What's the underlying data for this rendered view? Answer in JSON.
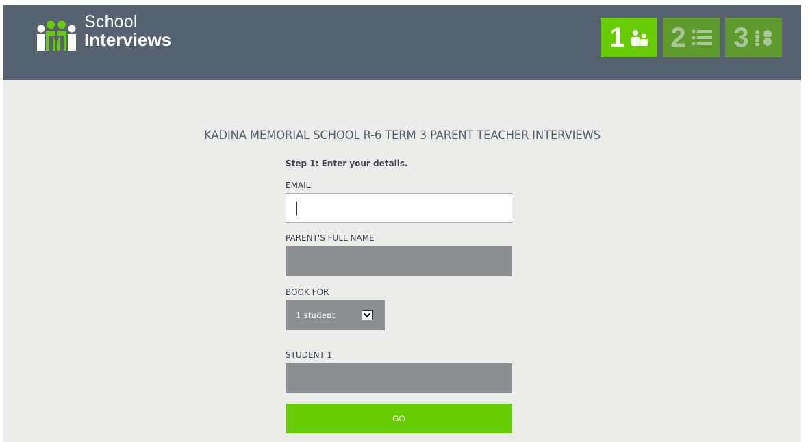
{
  "brand": {
    "line1": "School",
    "line2": "Interviews"
  },
  "steps": [
    {
      "number": "1",
      "icon": "people-icon",
      "state": "active"
    },
    {
      "number": "2",
      "icon": "list-icon",
      "state": "inactive"
    },
    {
      "number": "3",
      "icon": "people-list-icon",
      "state": "inactive"
    }
  ],
  "page": {
    "title": "KADINA MEMORIAL SCHOOL R-6 TERM 3 PARENT TEACHER INTERVIEWS"
  },
  "form": {
    "step_heading": "Step 1: Enter your details.",
    "email_label": "EMAIL",
    "email_value": "",
    "parent_label": "PARENT'S FULL NAME",
    "parent_value": "",
    "book_for_label": "BOOK FOR",
    "book_for_selected": "1 student",
    "student1_label": "STUDENT 1",
    "student1_value": "",
    "go_label": "GO"
  },
  "colors": {
    "header_bg": "#576271",
    "page_bg": "#ececea",
    "accent_green": "#66cc00",
    "inactive_green": "#5e9a2c",
    "field_grey": "#8b8f92"
  }
}
